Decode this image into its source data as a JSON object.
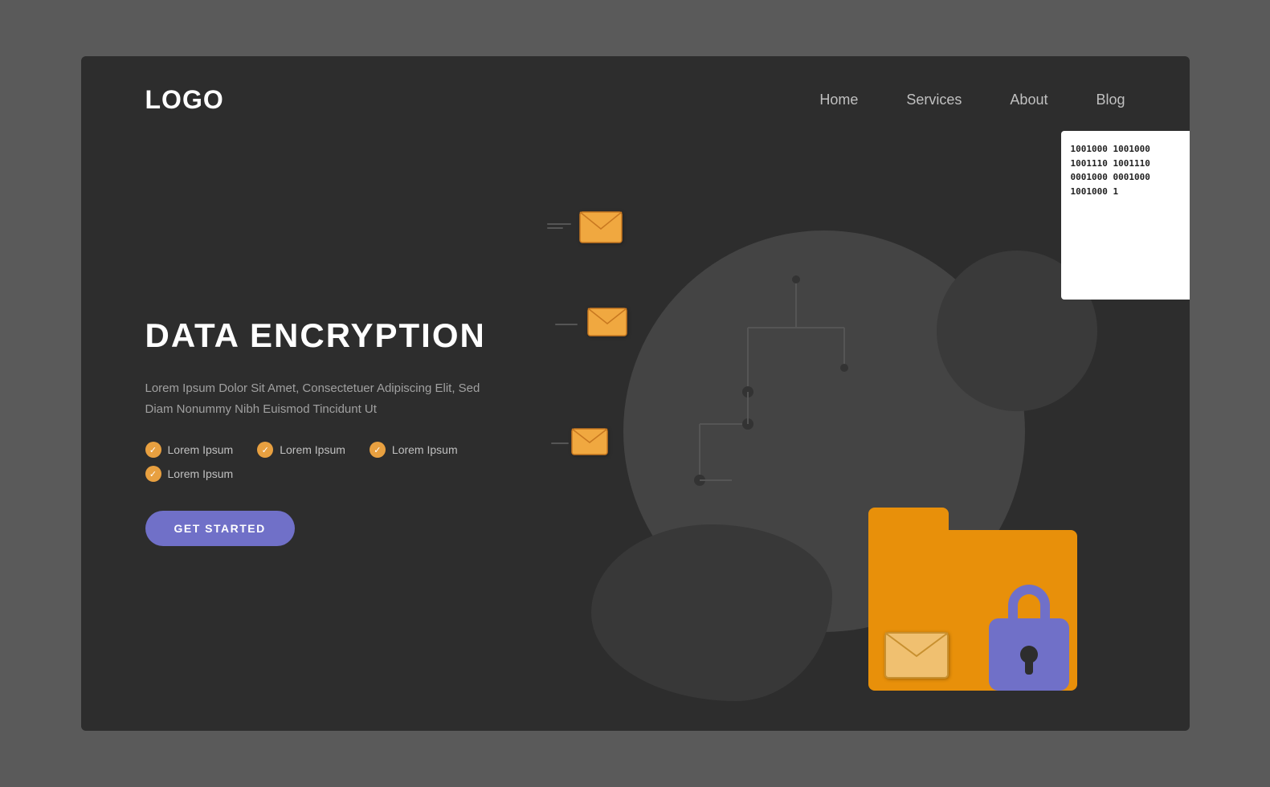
{
  "header": {
    "logo": "LOGO",
    "nav": {
      "items": [
        {
          "label": "Home",
          "id": "home"
        },
        {
          "label": "Services",
          "id": "services"
        },
        {
          "label": "About",
          "id": "about"
        },
        {
          "label": "Blog",
          "id": "blog"
        }
      ]
    }
  },
  "hero": {
    "headline": "DATA ENCRYPTION",
    "description": "Lorem Ipsum Dolor Sit Amet, Consectetuer Adipiscing Elit, Sed Diam Nonummy Nibh Euismod Tincidunt Ut",
    "checklist": [
      {
        "label": "Lorem Ipsum"
      },
      {
        "label": "Lorem Ipsum"
      },
      {
        "label": "Lorem Ipsum"
      },
      {
        "label": "Lorem Ipsum"
      }
    ],
    "cta_button": "GET STARTED"
  },
  "illustration": {
    "binary_lines_back": [
      "1001000 1001000",
      "1001110 1001110"
    ],
    "binary_lines_front": [
      "1001000 1001000",
      "1001110 1001110",
      "0001000 0001000",
      "1001000 1"
    ]
  },
  "colors": {
    "background": "#2d2d2d",
    "outer_bg": "#5a5a5a",
    "nav_text": "#c0c0c0",
    "headline": "#ffffff",
    "description": "#a0a0a0",
    "check_bg": "#e8a040",
    "cta_bg": "#7070c8",
    "folder_color": "#e8900a",
    "padlock_color": "#7070c8",
    "circle_bg": "#444444"
  }
}
